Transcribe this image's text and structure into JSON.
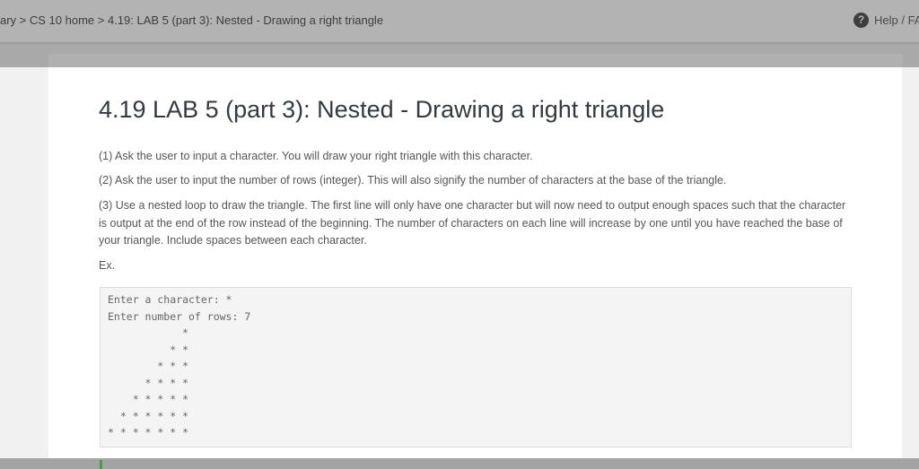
{
  "breadcrumb": "ary > CS 10 home > 4.19: LAB 5 (part 3): Nested - Drawing a right triangle",
  "help_label": "Help / FA",
  "title": "4.19 LAB 5 (part 3): Nested - Drawing a right triangle",
  "paragraphs": [
    "(1) Ask the user to input a character. You will draw your right triangle with this character.",
    "(2) Ask the user to input the number of rows (integer). This will also signify the number of characters at the base of the triangle.",
    "(3) Use a nested loop to draw the triangle. The first line will only have one character but will now need to output enough spaces such that the character is output at the end of the row instead of the beginning. The number of characters on each line will increase by one until you have reached the base of your triangle. Include spaces between each character.",
    "Ex."
  ],
  "example_output": "Enter a character: *\nEnter number of rows: 7\n            *\n          * *\n        * * *\n      * * * *\n    * * * * *\n  * * * * * *\n* * * * * * *"
}
